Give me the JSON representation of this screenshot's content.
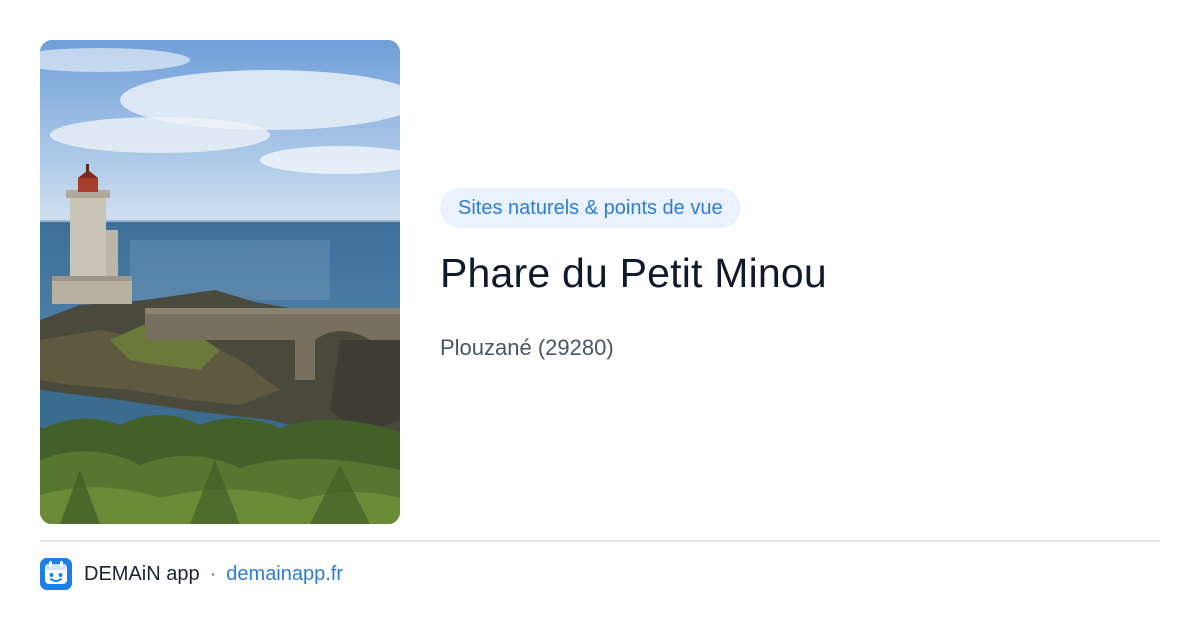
{
  "photo": {
    "icon": "lighthouse-photo",
    "colors": {
      "sky_top": "#6f9fd8",
      "sky_bottom": "#c9dcef",
      "sea": "#4e7fa6",
      "rock": "#4a4a3c",
      "vegetation": "#4f6e2e"
    }
  },
  "place": {
    "category": "Sites naturels & points de vue",
    "title": "Phare du Petit Minou",
    "location": "Plouzané (29280)"
  },
  "footer": {
    "app_name": "DEMAiN app",
    "separator": "·",
    "link": "demainapp.fr",
    "logo_icon": "demain-app-logo-icon"
  },
  "colors": {
    "accent": "#2f7cd6",
    "badge_bg": "#eaf3fd",
    "title": "#111a2b",
    "muted": "#4b5563",
    "divider": "#e3e8ec"
  }
}
